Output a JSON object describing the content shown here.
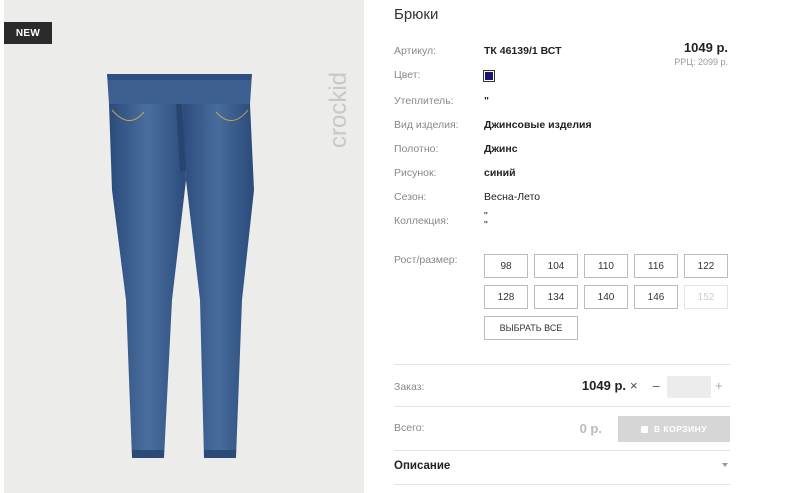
{
  "product": {
    "badge": "NEW",
    "brand": "crockid",
    "title": "Брюки",
    "price": "1049 р.",
    "rrp": "РРЦ: 2099 р.",
    "color_hex": "#1a1470"
  },
  "specs": [
    {
      "label": "Артикул:",
      "value": "ТК 46139/1 ВСТ"
    },
    {
      "label": "Цвет:",
      "value": ""
    },
    {
      "label": "Утеплитель:",
      "value": "\""
    },
    {
      "label": "Вид изделия:",
      "value": "Джинсовые изделия"
    },
    {
      "label": "Полотно:",
      "value": "Джинс"
    },
    {
      "label": "Рисунок:",
      "value": "синий"
    },
    {
      "label": "Сезон:",
      "value": "Весна-Лето"
    },
    {
      "label": "Коллекция:",
      "value": "\"\n\""
    }
  ],
  "sizes": {
    "label": "Рост/размер:",
    "options": [
      {
        "label": "98",
        "available": true
      },
      {
        "label": "104",
        "available": true
      },
      {
        "label": "110",
        "available": true
      },
      {
        "label": "116",
        "available": true
      },
      {
        "label": "122",
        "available": true
      },
      {
        "label": "128",
        "available": true
      },
      {
        "label": "134",
        "available": true
      },
      {
        "label": "140",
        "available": true
      },
      {
        "label": "146",
        "available": true
      },
      {
        "label": "152",
        "available": false
      }
    ],
    "select_all": "ВЫБРАТЬ ВСЕ"
  },
  "order": {
    "label": "Заказ:",
    "price": "1049 р.",
    "times": "×",
    "minus": "−",
    "plus": "+",
    "quantity": ""
  },
  "total": {
    "label": "Всего:",
    "value": "0 р.",
    "cart_button": "В КОРЗИНУ"
  },
  "description": {
    "label": "Описание"
  }
}
